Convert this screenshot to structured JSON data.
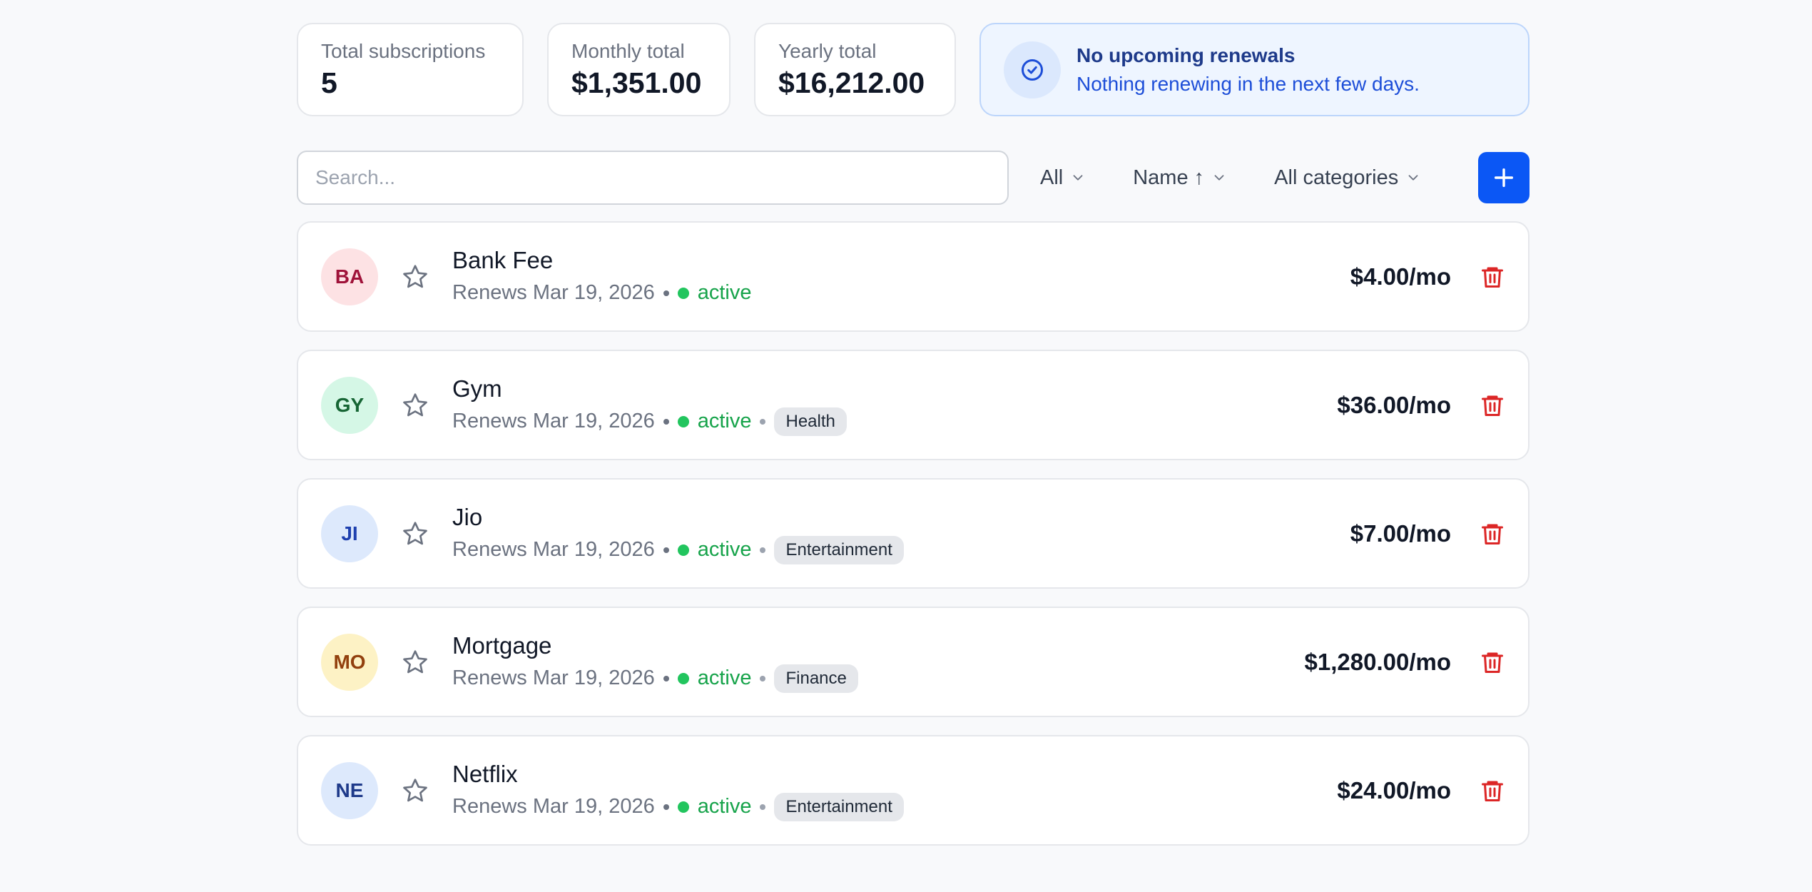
{
  "stats": {
    "total_label": "Total subscriptions",
    "total_value": "5",
    "monthly_label": "Monthly total",
    "monthly_value": "$1,351.00",
    "yearly_label": "Yearly total",
    "yearly_value": "$16,212.00"
  },
  "notice": {
    "title": "No upcoming renewals",
    "subtitle": "Nothing renewing in the next few days.",
    "icon": "check-circle-icon"
  },
  "toolbar": {
    "search_placeholder": "Search...",
    "search_value": "",
    "status_filter": "All",
    "sort_filter": "Name ↑",
    "category_filter": "All categories",
    "add_icon": "plus-icon"
  },
  "subscriptions": [
    {
      "initials": "BA",
      "name": "Bank Fee",
      "renews": "Renews Mar 19, 2026",
      "status": "active",
      "category": "",
      "price": "$4.00/mo"
    },
    {
      "initials": "GY",
      "name": "Gym",
      "renews": "Renews Mar 19, 2026",
      "status": "active",
      "category": "Health",
      "price": "$36.00/mo"
    },
    {
      "initials": "JI",
      "name": "Jio",
      "renews": "Renews Mar 19, 2026",
      "status": "active",
      "category": "Entertainment",
      "price": "$7.00/mo"
    },
    {
      "initials": "MO",
      "name": "Mortgage",
      "renews": "Renews Mar 19, 2026",
      "status": "active",
      "category": "Finance",
      "price": "$1,280.00/mo"
    },
    {
      "initials": "NE",
      "name": "Netflix",
      "renews": "Renews Mar 19, 2026",
      "status": "active",
      "category": "Entertainment",
      "price": "$24.00/mo"
    }
  ],
  "colors": {
    "accent": "#0b57f5",
    "active": "#22c55e",
    "delete": "#dc2626"
  }
}
